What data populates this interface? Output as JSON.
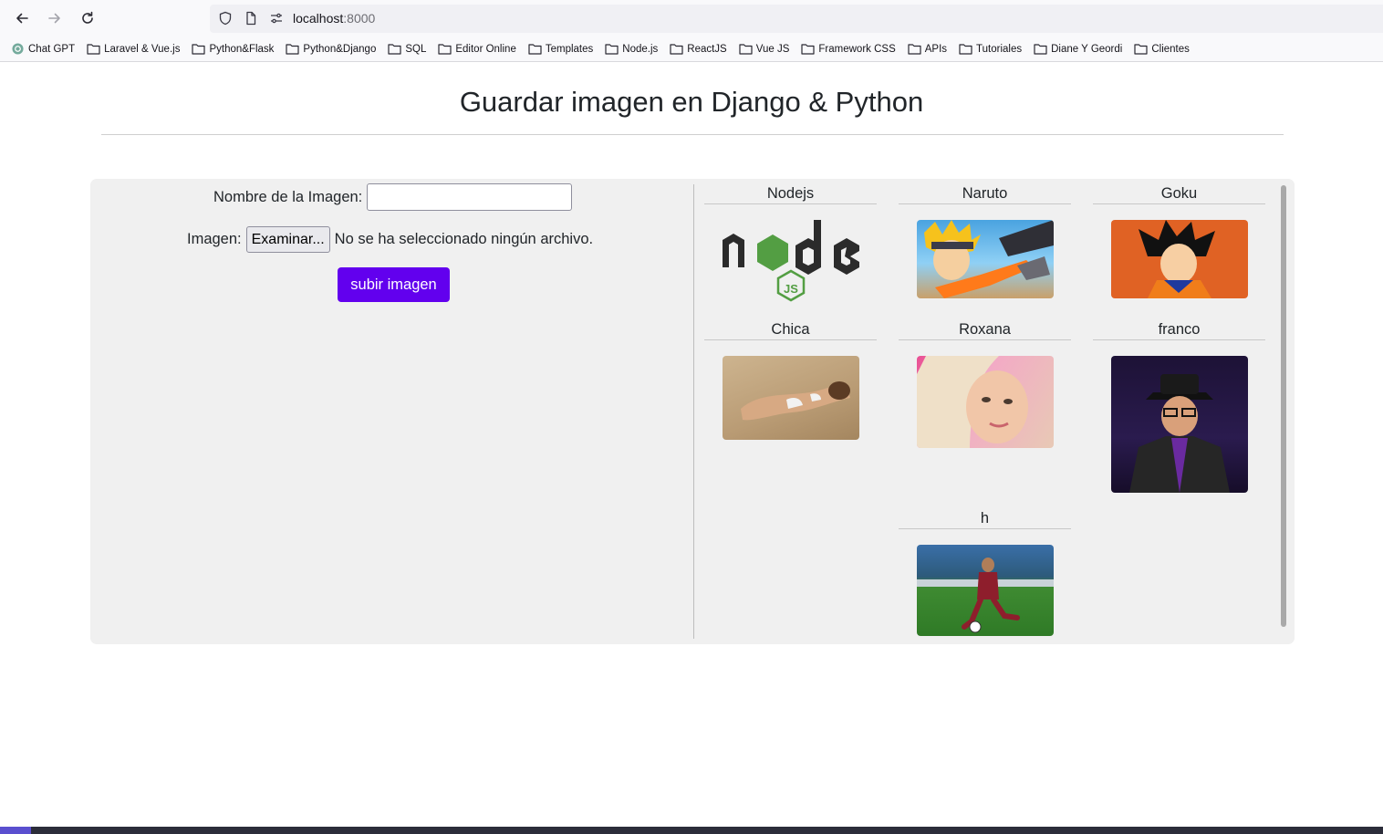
{
  "browser": {
    "url_host": "localhost",
    "url_port": ":8000",
    "bookmarks": [
      "Chat GPT",
      "Laravel & Vue.js",
      "Python&Flask",
      "Python&Django",
      "SQL",
      "Editor Online",
      "Templates",
      "Node.js",
      "ReactJS",
      "Vue JS",
      "Framework CSS",
      "APIs",
      "Tutoriales",
      "Diane Y Geordi",
      "Clientes"
    ]
  },
  "page": {
    "title": "Guardar imagen en Django & Python"
  },
  "form": {
    "name_label": "Nombre de la Imagen:",
    "name_value": "",
    "image_label": "Imagen:",
    "browse_button": "Examinar...",
    "no_file_text": "No se ha seleccionado ningún archivo.",
    "submit_button": "subir imagen"
  },
  "gallery": {
    "items": [
      {
        "caption": "Nodejs"
      },
      {
        "caption": "Naruto"
      },
      {
        "caption": "Goku"
      },
      {
        "caption": "Chica"
      },
      {
        "caption": "Roxana"
      },
      {
        "caption": "franco"
      },
      {
        "caption": "h"
      }
    ]
  },
  "colors": {
    "submit_bg": "#6200ee",
    "panel_bg": "#f0f0f0"
  }
}
